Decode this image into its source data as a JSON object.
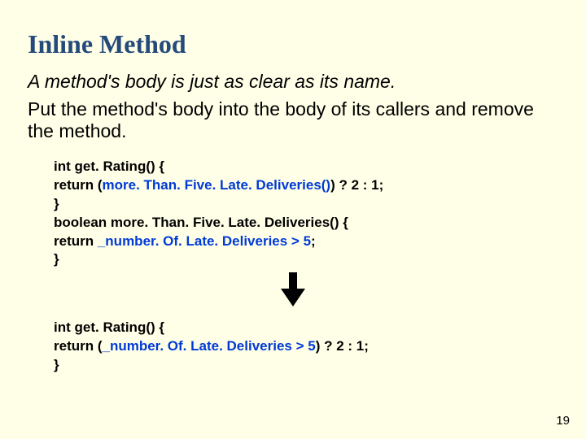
{
  "title": "Inline Method",
  "motivation": "A method's body is just as clear as its name.",
  "mechanics": "Put the method's body into the body of its callers and remove the method.",
  "code_before": {
    "l1": "int get. Rating() {",
    "l2a": "return (",
    "l2b": "more. Than. Five. Late. Deliveries()",
    "l2c": ") ? 2 : 1;",
    "l3": "}",
    "l4": "boolean more. Than. Five. Late. Deliveries() {",
    "l5a": "return ",
    "l5b": "_number. Of. Late. Deliveries > 5",
    "l5c": ";",
    "l6": "}"
  },
  "code_after": {
    "l1": "int get. Rating() {",
    "l2a": "return (",
    "l2b": "_number. Of. Late. Deliveries > 5",
    "l2c": ") ? 2 : 1;",
    "l3": "}"
  },
  "page_number": "19"
}
